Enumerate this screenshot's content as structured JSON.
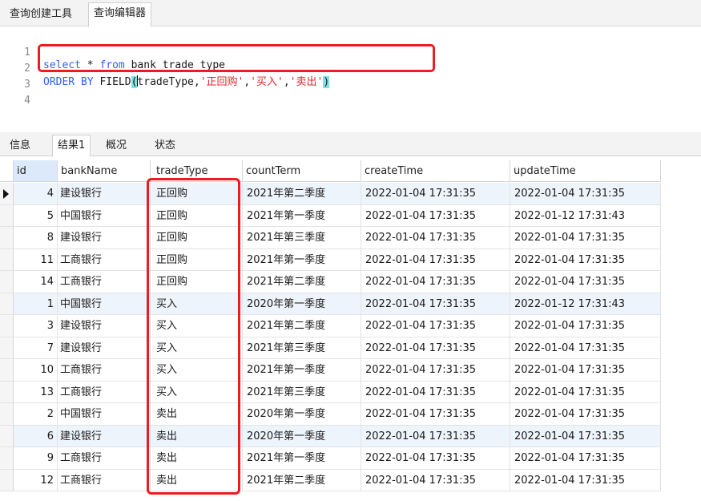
{
  "top_tabs": [
    "查询创建工具",
    "查询编辑器"
  ],
  "editor": {
    "line_numbers": [
      "1",
      "2",
      "3",
      "4"
    ],
    "line1": {
      "kw1": "select",
      "mid": " * ",
      "kw2": "from",
      "rest": " bank_trade_type"
    },
    "line2": {
      "kw": "ORDER BY",
      "fn": " FIELD",
      "open": "(",
      "arg": "tradeType,",
      "s1": "'正回购'",
      "c1": ",",
      "s2": "'买入'",
      "c2": ",",
      "s3": "'卖出'",
      "close": ")"
    }
  },
  "result_tabs": [
    "信息",
    "结果1",
    "概况",
    "状态"
  ],
  "table": {
    "columns": [
      "id",
      "bankName",
      "tradeType",
      "countTerm",
      "createTime",
      "updateTime"
    ],
    "rows": [
      [
        "4",
        "建设银行",
        "正回购",
        "2021年第二季度",
        "2022-01-04 17:31:35",
        "2022-01-04 17:31:35"
      ],
      [
        "5",
        "中国银行",
        "正回购",
        "2021年第一季度",
        "2022-01-04 17:31:35",
        "2022-01-12 17:31:43"
      ],
      [
        "8",
        "建设银行",
        "正回购",
        "2021年第三季度",
        "2022-01-04 17:31:35",
        "2022-01-04 17:31:35"
      ],
      [
        "11",
        "工商银行",
        "正回购",
        "2021年第一季度",
        "2022-01-04 17:31:35",
        "2022-01-04 17:31:35"
      ],
      [
        "14",
        "工商银行",
        "正回购",
        "2021年第二季度",
        "2022-01-04 17:31:35",
        "2022-01-04 17:31:35"
      ],
      [
        "1",
        "中国银行",
        "买入",
        "2020年第一季度",
        "2022-01-04 17:31:35",
        "2022-01-12 17:31:43"
      ],
      [
        "3",
        "建设银行",
        "买入",
        "2021年第二季度",
        "2022-01-04 17:31:35",
        "2022-01-04 17:31:35"
      ],
      [
        "7",
        "建设银行",
        "买入",
        "2021年第三季度",
        "2022-01-04 17:31:35",
        "2022-01-04 17:31:35"
      ],
      [
        "10",
        "工商银行",
        "买入",
        "2021年第一季度",
        "2022-01-04 17:31:35",
        "2022-01-04 17:31:35"
      ],
      [
        "13",
        "工商银行",
        "买入",
        "2021年第三季度",
        "2022-01-04 17:31:35",
        "2022-01-04 17:31:35"
      ],
      [
        "2",
        "中国银行",
        "卖出",
        "2020年第一季度",
        "2022-01-04 17:31:35",
        "2022-01-04 17:31:35"
      ],
      [
        "6",
        "建设银行",
        "卖出",
        "2020年第一季度",
        "2022-01-04 17:31:35",
        "2022-01-04 17:31:35"
      ],
      [
        "9",
        "工商银行",
        "卖出",
        "2021年第一季度",
        "2022-01-04 17:31:35",
        "2022-01-04 17:31:35"
      ],
      [
        "12",
        "工商银行",
        "卖出",
        "2021年第二季度",
        "2022-01-04 17:31:35",
        "2022-01-04 17:31:35"
      ]
    ]
  },
  "colors": {
    "annotation": "#ee1c1c",
    "keyword": "#2f5ff5",
    "string": "#e0272f",
    "bracket_match": "#7fe3e6",
    "selected_header": "#dbe9fb"
  },
  "icons": {
    "current_row": "row-pointer-icon"
  }
}
